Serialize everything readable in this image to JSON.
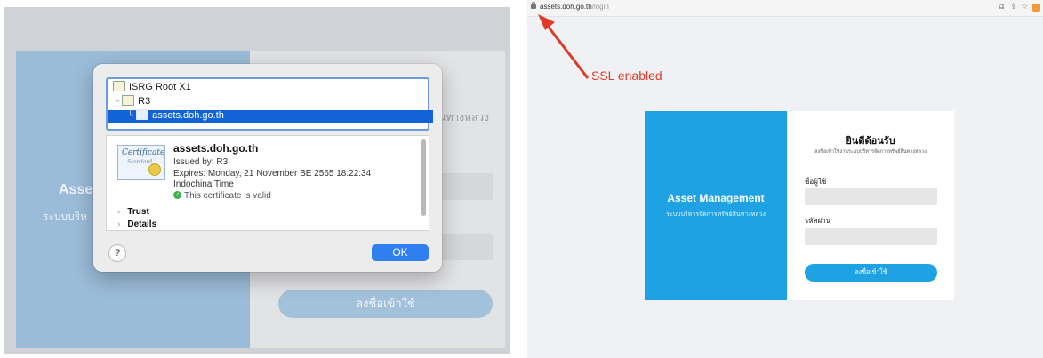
{
  "left_screenshot": {
    "background_login": {
      "title": "Asse",
      "subtitle": "ระบบบริห",
      "form_subtitle": "สินทางหลวง",
      "login_button": "ลงชื่อเข้าใช้"
    },
    "certificate_dialog": {
      "tree": [
        {
          "label": "ISRG Root X1",
          "indent": "",
          "selected": false
        },
        {
          "label": "R3",
          "indent": "└",
          "selected": false
        },
        {
          "label": "assets.doh.go.th",
          "indent": "└",
          "selected": true
        }
      ],
      "cert_name": "assets.doh.go.th",
      "issued_by": "Issued by: R3",
      "expires": "Expires: Monday, 21 November BE 2565 18:22:34",
      "timezone": "Indochina Time",
      "valid_text": "This certificate is valid",
      "cert_image_text": "Certificate",
      "cert_image_subtext": "Standard",
      "sections": [
        "Trust",
        "Details"
      ],
      "help_button": "?",
      "ok_button": "OK",
      "valid_color": "#3ab34a",
      "selection_color": "#1264d6"
    }
  },
  "right_screenshot": {
    "browser": {
      "url_host": "assets.doh.go.th",
      "url_path": "/login"
    },
    "annotation": {
      "label": "SSL enabled",
      "color": "#e03a26"
    },
    "login": {
      "app_title": "Asset Management",
      "app_subtitle": "ระบบบริหารจัดการทรัพย์สินทางหลวง",
      "welcome": "ยินดีต้อนรับ",
      "welcome_sub": "ลงชื่อเข้าใช้งานระบบบริหารจัดการทรัพย์สินทางหลวง",
      "username_label": "ชื่อผู้ใช้",
      "password_label": "รหัสผ่าน",
      "login_button": "ลงชื่อเข้าใช้",
      "accent_color": "#1ea2e4"
    }
  }
}
